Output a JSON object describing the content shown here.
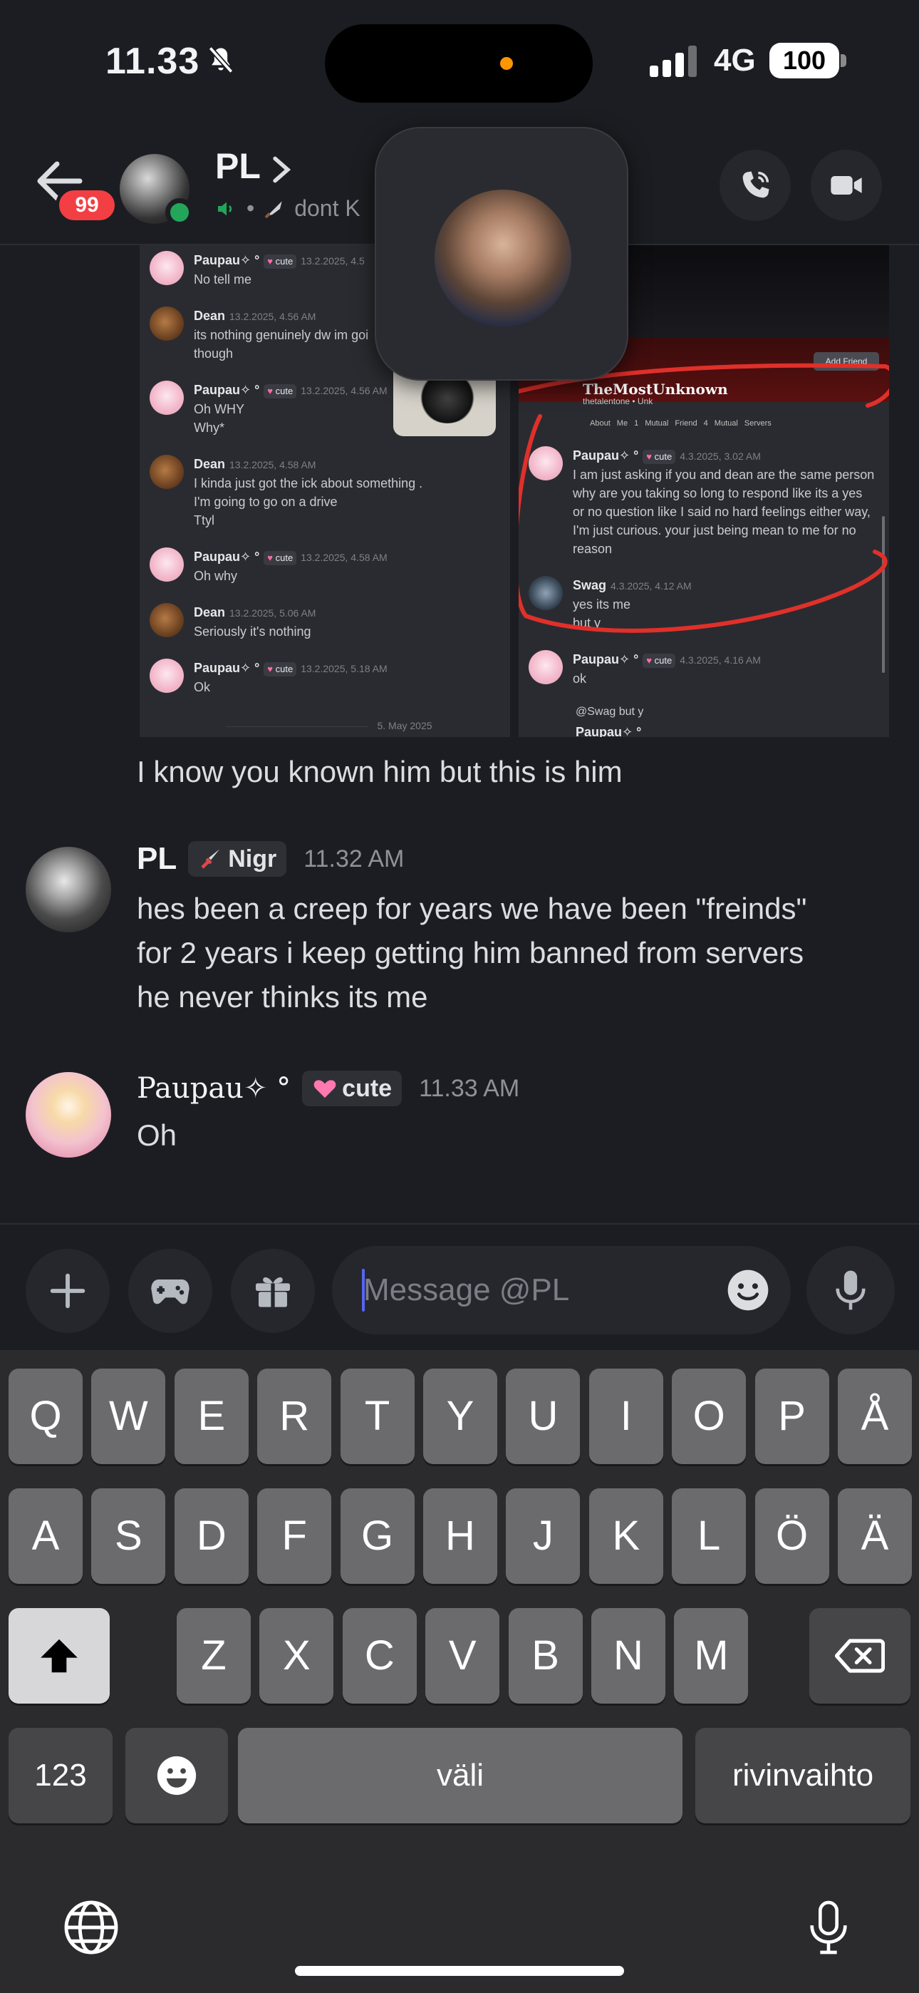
{
  "status_bar": {
    "time": "11.33",
    "network": "4G",
    "battery": "100"
  },
  "header": {
    "name": "PL",
    "unread_count": "99",
    "status_text": "dont K"
  },
  "attachments": {
    "left_messages": [
      {
        "author": "Paupau✧ °",
        "tag": "cute",
        "ts": "13.2.2025, 4.5",
        "lines": [
          "No tell me"
        ]
      },
      {
        "author": "Dean",
        "tag": "",
        "ts": "13.2.2025, 4.56 AM",
        "lines": [
          "its nothing genuinely dw im goi",
          "though"
        ]
      },
      {
        "author": "Paupau✧ °",
        "tag": "cute",
        "ts": "13.2.2025, 4.56 AM",
        "lines": [
          "Oh WHY",
          "Why*"
        ]
      },
      {
        "author": "Dean",
        "tag": "",
        "ts": "13.2.2025, 4.58 AM",
        "lines": [
          "I kinda just got the ick about something .",
          "I'm going to go on a drive",
          "Ttyl"
        ]
      },
      {
        "author": "Paupau✧ °",
        "tag": "cute",
        "ts": "13.2.2025, 4.58 AM",
        "lines": [
          "Oh why"
        ]
      },
      {
        "author": "Dean",
        "tag": "",
        "ts": "13.2.2025, 5.06 AM",
        "lines": [
          "Seriously it's nothing"
        ]
      },
      {
        "author": "Paupau✧ °",
        "tag": "cute",
        "ts": "13.2.2025, 5.18 AM",
        "lines": [
          "Ok"
        ]
      }
    ],
    "left_date_divider": "5. May 2025",
    "right_profile": {
      "name": "TheMostUnknown",
      "sub": "thetalentone • Unk",
      "add_friend": "Add Friend",
      "tabs": "About Me   1 Mutual Friend   4 Mutual Servers"
    },
    "right_messages": [
      {
        "author": "Paupau✧ °",
        "tag": "cute",
        "ts": "4.3.2025, 3.02 AM",
        "lines": [
          "I am just asking if you and dean are the same person",
          "why are you taking so long to respond like its a yes",
          "or no question like I said no hard feelings either way,",
          "I'm just curious. your just being mean to me for no",
          "reason"
        ]
      },
      {
        "author": "Swag",
        "tag": "",
        "ts": "4.3.2025, 4.12 AM",
        "lines": [
          "yes its me",
          "but y"
        ]
      },
      {
        "author": "Paupau✧ °",
        "tag": "cute",
        "ts": "4.3.2025, 4.16 AM",
        "lines": [
          "ok"
        ]
      }
    ],
    "right_reply_preview": "@Swag  but y",
    "right_cut_author": "Paupau✧ °"
  },
  "messages": [
    {
      "continuation": true,
      "text": "I know you known him but this is him"
    },
    {
      "author": "PL",
      "role": "Nigr",
      "time": "11.32 AM",
      "lines": [
        "hes been a creep for years we have been \"freinds\"",
        "for 2 years i keep getting him banned from servers",
        "he never thinks its me"
      ]
    },
    {
      "author": "Paupau✧ °",
      "role": "cute",
      "time": "11.33 AM",
      "lines": [
        "Oh"
      ]
    }
  ],
  "composer": {
    "placeholder": "Message @PL"
  },
  "keyboard": {
    "row1": [
      "Q",
      "W",
      "E",
      "R",
      "T",
      "Y",
      "U",
      "I",
      "O",
      "P",
      "Å"
    ],
    "row2": [
      "A",
      "S",
      "D",
      "F",
      "G",
      "H",
      "J",
      "K",
      "L",
      "Ö",
      "Ä"
    ],
    "row3": [
      "Z",
      "X",
      "C",
      "V",
      "B",
      "N",
      "M"
    ],
    "numbers": "123",
    "space": "väli",
    "return": "rivinvaihto"
  },
  "colors": {
    "online": "#23a55a",
    "badge": "#f23f43",
    "accent": "#5865f2",
    "annotation": "#e0302a"
  }
}
